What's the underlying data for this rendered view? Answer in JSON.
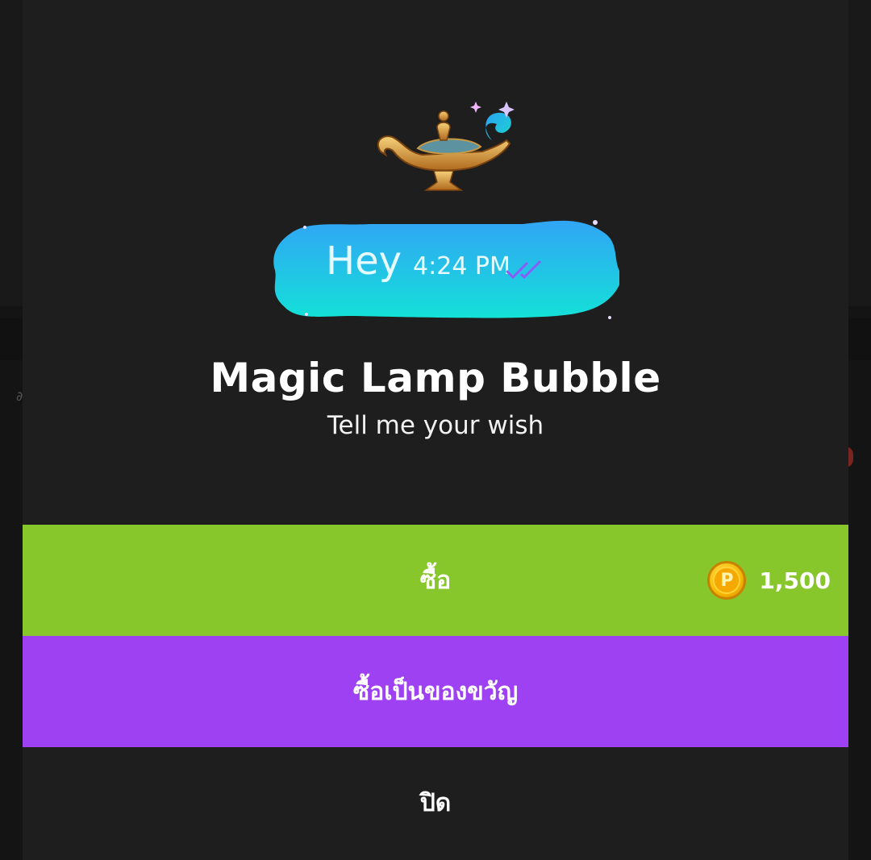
{
  "item": {
    "title": "Magic Lamp Bubble",
    "subtitle": "Tell me your wish",
    "preview": {
      "message_text": "Hey",
      "message_time": "4:24 PM",
      "bubble_icon": "magic-lamp",
      "read_indicator_icon": "double-check-icon"
    }
  },
  "actions": {
    "buy_label": "ซื้อ",
    "gift_label": "ซื้อเป็นของขวัญ",
    "close_label": "ปิด"
  },
  "price": {
    "currency_icon": "coin-icon",
    "currency_symbol": "P",
    "amount": "1,500"
  },
  "colors": {
    "buy": "#88c72c",
    "gift": "#9d41f2",
    "modal_bg": "#1e1e1e",
    "bubble": "#22d3e6"
  }
}
